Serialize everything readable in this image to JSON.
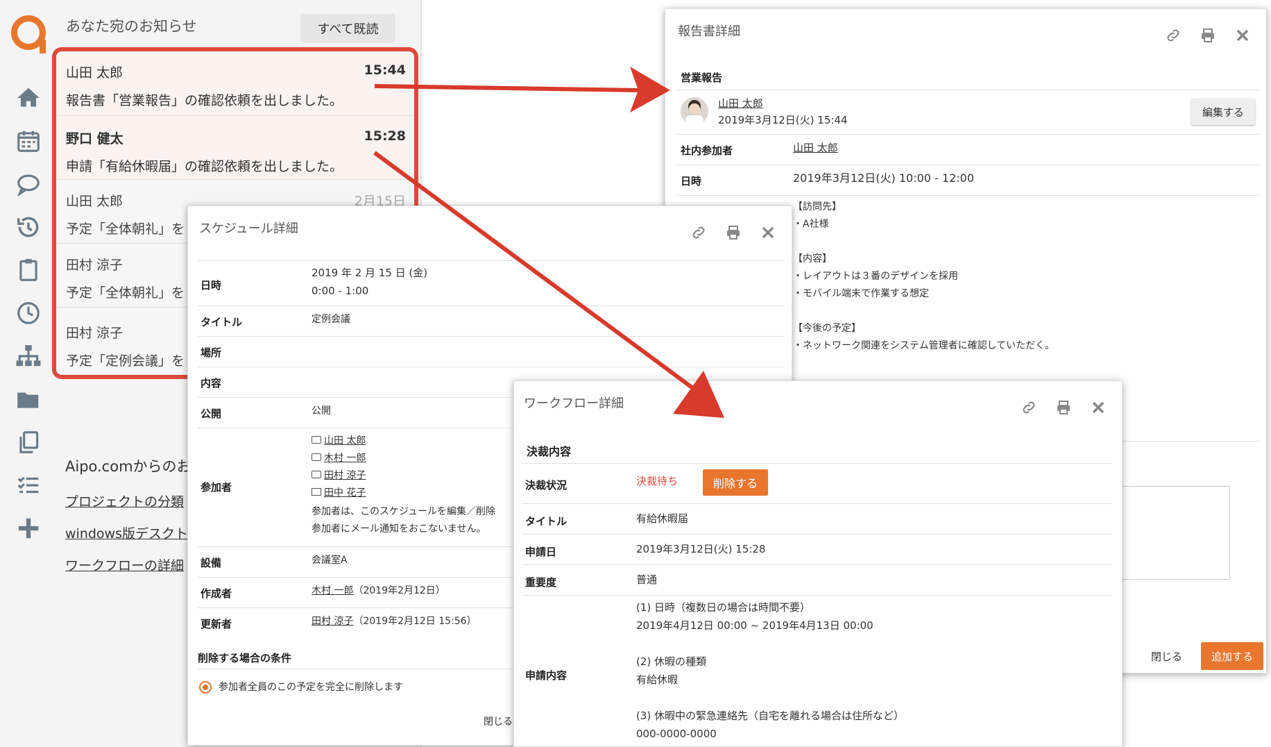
{
  "notifications": {
    "title": "あなた宛のお知らせ",
    "mark_all_read": "すべて既読",
    "items": [
      {
        "name": "山田 太郎",
        "time": "15:44",
        "message": "報告書「営業報告」の確認依頼を出しました。"
      },
      {
        "name": "野口 健太",
        "time": "15:28",
        "message": "申請「有給休暇届」の確認依頼を出しました。"
      },
      {
        "name": "山田 太郎",
        "time": "2月15日",
        "message": "予定「全体朝礼」を"
      },
      {
        "name": "田村 涼子",
        "time": "",
        "message": "予定「全体朝礼」を"
      },
      {
        "name": "田村 涼子",
        "time": "",
        "message": "予定「定例会議」を"
      }
    ]
  },
  "aipo": {
    "title": "Aipo.comからのお",
    "links": [
      "プロジェクトの分類",
      "windows版デスクト",
      "ワークフローの詳細"
    ]
  },
  "sidebar_icons": [
    "home-icon",
    "calendar-icon",
    "chat-icon",
    "history-icon",
    "clipboard-icon",
    "clock-icon",
    "org-chart-icon",
    "folder-icon",
    "copy-icon",
    "list-icon",
    "plus-icon"
  ],
  "report": {
    "title": "報告書詳細",
    "section": "営業報告",
    "author": "山田 太郎",
    "posted": "2019年3月12日(火) 15:44",
    "edit_button": "編集する",
    "participants_label": "社内参加者",
    "participants": "山田 太郎",
    "datetime_label": "日時",
    "datetime": "2019年3月12日(火) 10:00 - 12:00",
    "body_lines": [
      "【訪問先】",
      "・A社様",
      "",
      "【内容】",
      "・レイアウトは３番のデザインを採用",
      "・モバイル端末で作業する想定",
      "",
      "【今後の予定】",
      "・ネットワーク関連をシステム管理者に確認していただく。"
    ],
    "close": "閉じる",
    "add": "追加する"
  },
  "schedule": {
    "title": "スケジュール詳細",
    "date_label": "日時",
    "date_line1": "2019 年 2 月 15 日 (金)",
    "date_line2": "0:00 - 1:00",
    "title_label": "タイトル",
    "title_value": "定例会議",
    "place_label": "場所",
    "content_label": "内容",
    "public_label": "公開",
    "public_value": "公開",
    "attendees_label": "参加者",
    "attendees": [
      "山田 太郎",
      "木村 一郎",
      "田村 涼子",
      "田中 花子"
    ],
    "note1": "参加者は、このスケジュールを編集／削除",
    "note2": "参加者にメール通知をおこないません。",
    "equipment_label": "設備",
    "equipment_value": "会議室A",
    "creator_label": "作成者",
    "creator": "木村 一郎",
    "creator_date": "（2019年2月12日）",
    "updater_label": "更新者",
    "updater": "田村 涼子",
    "updater_date": "（2019年2月12日 15:56）",
    "delete_cond": "削除する場合の条件",
    "delete_option": "参加者全員のこの予定を完全に削除します",
    "close": "閉じる"
  },
  "workflow": {
    "title": "ワークフロー詳細",
    "section": "決裁内容",
    "status_label": "決裁状況",
    "status_value": "決裁待ち",
    "delete_button": "削除する",
    "title_label": "タイトル",
    "title_value": "有給休暇届",
    "date_label": "申請日",
    "date_value": "2019年3月12日(火) 15:28",
    "priority_label": "重要度",
    "priority_value": "普通",
    "content_label": "申請内容",
    "content_lines": [
      "(1) 日時（複数日の場合は時間不要）",
      "2019年4月12日 00:00 ~ 2019年4月13日 00:00",
      "",
      "(2) 休暇の種類",
      "有給休暇",
      "",
      "(3) 休暇中の緊急連絡先（自宅を離れる場合は住所など）",
      "000-0000-0000"
    ]
  },
  "colors": {
    "accent": "#e8762d",
    "highlight_border": "#e0493a",
    "arrow": "#d83a2b",
    "status_red": "#e0493a"
  }
}
